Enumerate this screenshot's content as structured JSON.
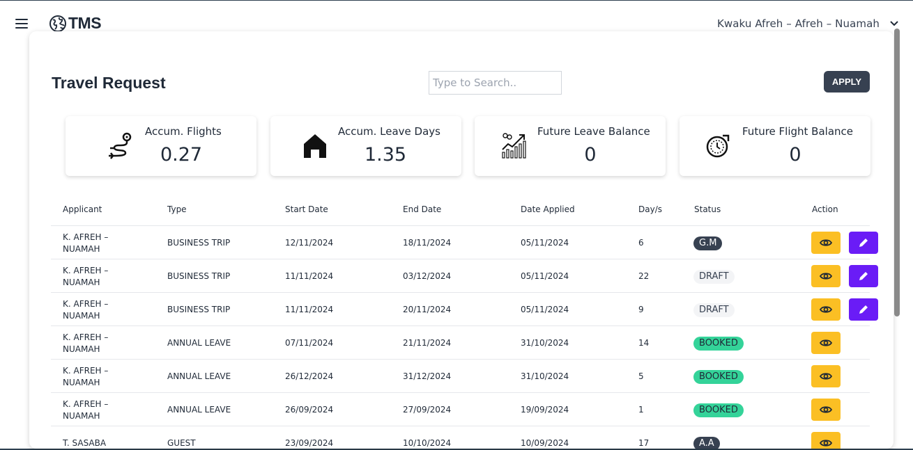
{
  "header": {
    "logo_text": "TMS",
    "user_name": "Kwaku Afreh – Afreh – Nuamah"
  },
  "page": {
    "title": "Travel Request",
    "search_placeholder": "Type to Search..",
    "apply_label": "APPLY"
  },
  "stats": [
    {
      "label": "Accum. Flights",
      "value": "0.27",
      "icon": "flight-route-icon"
    },
    {
      "label": "Accum. Leave Days",
      "value": "1.35",
      "icon": "house-icon"
    },
    {
      "label": "Future Leave Balance",
      "value": "0",
      "icon": "growth-chart-icon"
    },
    {
      "label": "Future Flight Balance",
      "value": "0",
      "icon": "clock-cycle-icon"
    }
  ],
  "table": {
    "headers": [
      "Applicant",
      "Type",
      "Start Date",
      "End Date",
      "Date Applied",
      "Day/s",
      "Status",
      "Action"
    ],
    "rows": [
      {
        "applicant": "K. AFREH – NUAMAH",
        "type": "BUSINESS TRIP",
        "start": "12/11/2024",
        "end": "18/11/2024",
        "applied": "05/11/2024",
        "days": "6",
        "status": "G.M"
      },
      {
        "applicant": "K. AFREH – NUAMAH",
        "type": "BUSINESS TRIP",
        "start": "11/11/2024",
        "end": "03/12/2024",
        "applied": "05/11/2024",
        "days": "22",
        "status": "DRAFT"
      },
      {
        "applicant": "K. AFREH – NUAMAH",
        "type": "BUSINESS TRIP",
        "start": "11/11/2024",
        "end": "20/11/2024",
        "applied": "05/11/2024",
        "days": "9",
        "status": "DRAFT"
      },
      {
        "applicant": "K. AFREH – NUAMAH",
        "type": "ANNUAL LEAVE",
        "start": "07/11/2024",
        "end": "21/11/2024",
        "applied": "31/10/2024",
        "days": "14",
        "status": "BOOKED"
      },
      {
        "applicant": "K. AFREH – NUAMAH",
        "type": "ANNUAL LEAVE",
        "start": "26/12/2024",
        "end": "31/12/2024",
        "applied": "31/10/2024",
        "days": "5",
        "status": "BOOKED"
      },
      {
        "applicant": "K. AFREH – NUAMAH",
        "type": "ANNUAL LEAVE",
        "start": "26/09/2024",
        "end": "27/09/2024",
        "applied": "19/09/2024",
        "days": "1",
        "status": "BOOKED"
      },
      {
        "applicant": "T. SASABA",
        "type": "GUEST",
        "start": "23/09/2024",
        "end": "10/10/2024",
        "applied": "10/09/2024",
        "days": "17",
        "status": "A.A"
      }
    ]
  },
  "colors": {
    "status_dark": "#374151",
    "status_draft": "#f3f4f6",
    "status_booked": "#34d399",
    "view_button": "#fbbf24",
    "edit_button": "#6a1cf6"
  }
}
